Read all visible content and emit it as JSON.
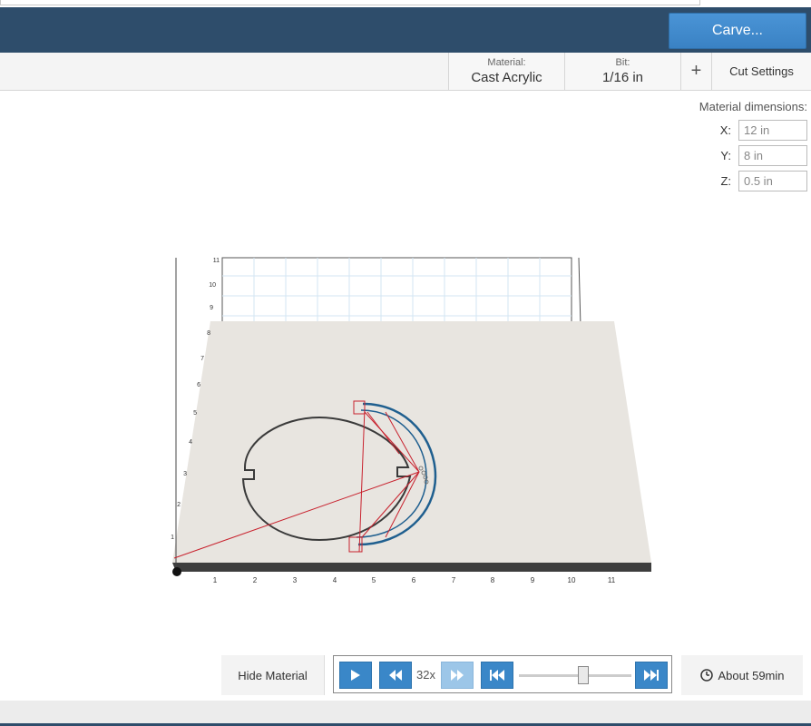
{
  "header": {
    "carve_label": "Carve..."
  },
  "toolbar": {
    "material_label": "Material:",
    "material_value": "Cast Acrylic",
    "bit_label": "Bit:",
    "bit_value": "1/16 in",
    "plus_label": "+",
    "cut_settings_label": "Cut Settings"
  },
  "dimensions": {
    "title": "Material dimensions:",
    "x_label": "X:",
    "x_value": "12 in",
    "y_label": "Y:",
    "y_value": "8 in",
    "z_label": "Z:",
    "z_value": "0.5 in"
  },
  "viewport": {
    "x_ticks": [
      "1",
      "2",
      "3",
      "4",
      "5",
      "6",
      "7",
      "8",
      "9",
      "10",
      "11"
    ],
    "y_ticks": [
      "1",
      "2",
      "3",
      "4",
      "5",
      "6",
      "7",
      "8",
      "9",
      "10",
      "11"
    ],
    "material_color": "#e8e5e0",
    "path_color_red": "#c8222e",
    "path_color_blue": "#1f5f8f"
  },
  "controls": {
    "hide_material_label": "Hide Material",
    "speed_label": "32x",
    "time_label": "About 59min",
    "icons": [
      "play-icon",
      "rewind-icon",
      "fast-forward-icon",
      "skip-to-start-icon",
      "skip-to-end-icon",
      "clock-icon"
    ]
  }
}
